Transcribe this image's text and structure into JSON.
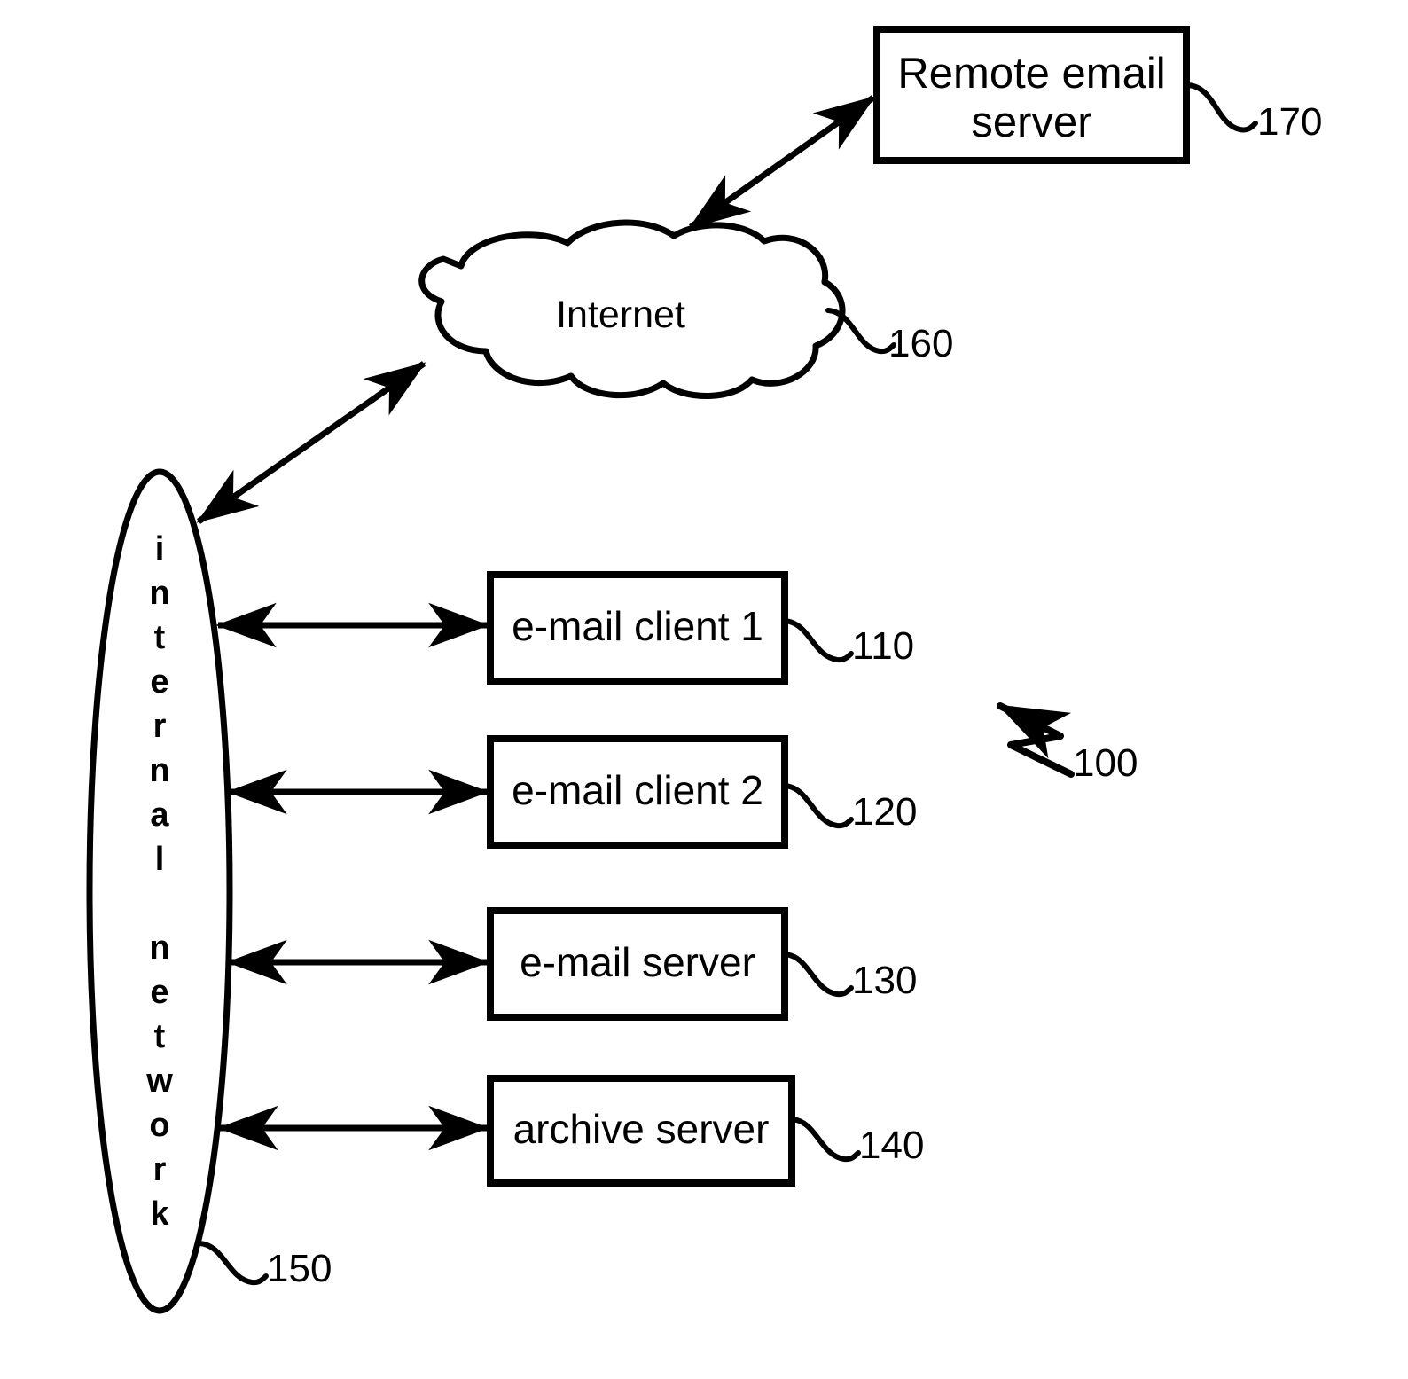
{
  "figure": {
    "type": "patent-block-diagram",
    "background_color": "#ffffff",
    "stroke_color": "#000000",
    "system_reference": "100"
  },
  "nodes": {
    "remote_email_server": {
      "label": "Remote email\nserver",
      "ref": "170",
      "shape": "rectangle"
    },
    "internet": {
      "label": "Internet",
      "ref": "160",
      "shape": "cloud"
    },
    "internal_network": {
      "label": "internal network",
      "letters": [
        "i",
        "n",
        "t",
        "e",
        "r",
        "n",
        "a",
        "l",
        " ",
        "n",
        "e",
        "t",
        "w",
        "o",
        "r",
        "k"
      ],
      "ref": "150",
      "shape": "ellipse",
      "orientation": "vertical-text"
    },
    "email_client_1": {
      "label": "e-mail client 1",
      "ref": "110",
      "shape": "rectangle"
    },
    "email_client_2": {
      "label": "e-mail client 2",
      "ref": "120",
      "shape": "rectangle"
    },
    "email_server": {
      "label": "e-mail server",
      "ref": "130",
      "shape": "rectangle"
    },
    "archive_server": {
      "label": "archive server",
      "ref": "140",
      "shape": "rectangle"
    }
  },
  "connections": [
    {
      "from": "internet",
      "to": "remote_email_server",
      "style": "double-arrow"
    },
    {
      "from": "internal_network",
      "to": "internet",
      "style": "double-arrow"
    },
    {
      "from": "internal_network",
      "to": "email_client_1",
      "style": "double-arrow"
    },
    {
      "from": "internal_network",
      "to": "email_client_2",
      "style": "double-arrow"
    },
    {
      "from": "internal_network",
      "to": "email_server",
      "style": "double-arrow"
    },
    {
      "from": "internal_network",
      "to": "archive_server",
      "style": "double-arrow"
    }
  ],
  "callouts": [
    {
      "ref": "170",
      "target": "remote_email_server"
    },
    {
      "ref": "160",
      "target": "internet"
    },
    {
      "ref": "110",
      "target": "email_client_1"
    },
    {
      "ref": "120",
      "target": "email_client_2"
    },
    {
      "ref": "130",
      "target": "email_server"
    },
    {
      "ref": "140",
      "target": "archive_server"
    },
    {
      "ref": "150",
      "target": "internal_network"
    },
    {
      "ref": "100",
      "target": "whole-system"
    }
  ]
}
